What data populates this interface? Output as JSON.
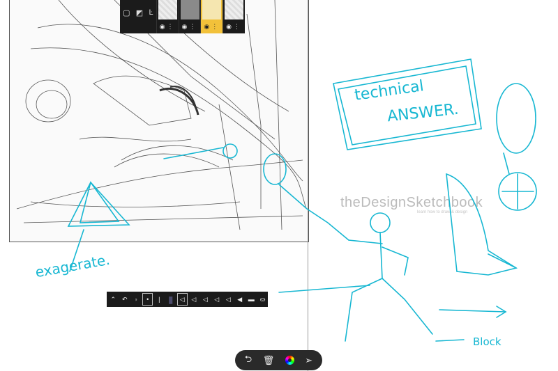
{
  "layers_panel": {
    "tools": [
      {
        "icon": "new-layer-icon",
        "glyph": "▢"
      },
      {
        "icon": "import-image-icon",
        "glyph": "◩"
      },
      {
        "icon": "merge-layer-icon",
        "glyph": "Ŀ"
      }
    ],
    "thumbnails": [
      {
        "name": "layer-1",
        "selected": false
      },
      {
        "name": "layer-2",
        "selected": false
      },
      {
        "name": "layer-3",
        "selected": true,
        "accent": "#f2c13a"
      },
      {
        "name": "layer-4",
        "selected": false
      }
    ]
  },
  "brush_toolbar": {
    "items": [
      {
        "icon": "collapse-icon",
        "glyph": "⌃"
      },
      {
        "icon": "brush-mode-icon",
        "glyph": "↶"
      },
      {
        "icon": "eraser-icon",
        "glyph": "◗"
      },
      {
        "icon": "brush-size-icon",
        "glyph": "•"
      },
      {
        "icon": "opacity-icon",
        "glyph": "|"
      },
      {
        "icon": "color-swatch-icon",
        "glyph": "▮"
      },
      {
        "icon": "pencil-tool-icon",
        "glyph": "◁"
      },
      {
        "icon": "fine-pen-icon",
        "glyph": "◁"
      },
      {
        "icon": "ballpoint-pen-icon",
        "glyph": "◁"
      },
      {
        "icon": "marker-icon",
        "glyph": "◁"
      },
      {
        "icon": "airbrush-icon",
        "glyph": "◁"
      },
      {
        "icon": "paint-brush-icon",
        "glyph": "◀"
      },
      {
        "icon": "flat-marker-icon",
        "glyph": "▬"
      },
      {
        "icon": "fill-bucket-icon",
        "glyph": "⛀"
      }
    ]
  },
  "watermark": {
    "title": "theDesignSketchbook",
    "subtitle": "learn how to draw & design"
  },
  "annotations": {
    "technical": "technical",
    "answer": "ANSWER.",
    "exaggerate": "exagerate.",
    "block": "Block"
  },
  "dock": {
    "undo_icon": "undo-icon",
    "trash_icon": "trash-icon",
    "color_icon": "color-wheel-icon",
    "share_icon": "share-icon"
  },
  "colors": {
    "annotation": "#17b7d2",
    "panel": "#1b1b1b",
    "selected_layer": "#f2c13a"
  }
}
